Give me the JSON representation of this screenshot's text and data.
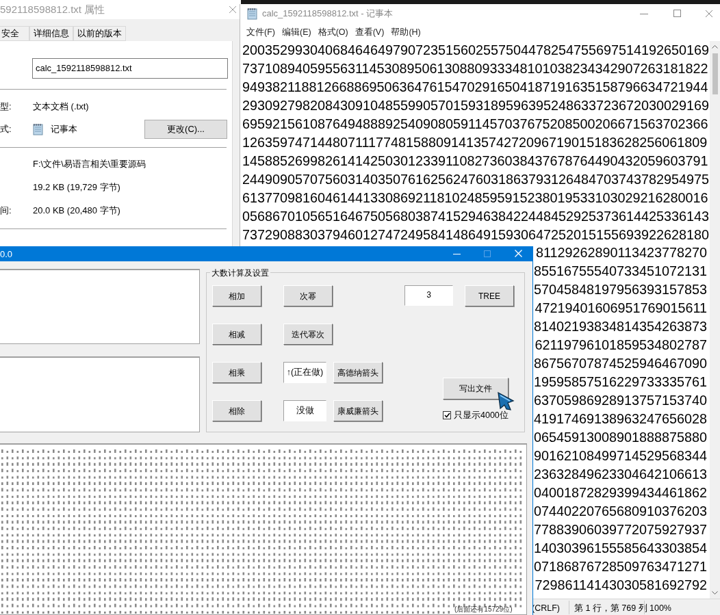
{
  "properties_dialog": {
    "title": "592118598812.txt 属性",
    "tabs": [
      {
        "label": "安全",
        "selected": false
      },
      {
        "label": "详细信息",
        "selected": false
      },
      {
        "label": "以前的版本",
        "selected": false
      }
    ],
    "file_name": "calc_1592118598812.txt",
    "rows": [
      {
        "kind": "text",
        "label": "型:",
        "value": "文本文档 (.txt)"
      },
      {
        "kind": "app",
        "label": "式:",
        "value": "记事本",
        "button": "更改(C)..."
      },
      {
        "kind": "text",
        "value": "F:\\文件\\易语言相关\\重要源码"
      },
      {
        "kind": "text",
        "value": "19.2 KB (19,729 字节)"
      },
      {
        "kind": "text",
        "label": "间:",
        "value": "20.0 KB (20,480 字节)"
      }
    ]
  },
  "notepad": {
    "title": "calc_1592118598812.txt - 记事本",
    "menu": [
      "文件(F)",
      "编辑(E)",
      "格式(O)",
      "查看(V)",
      "帮助(H)"
    ],
    "lines": [
      "20035299304068464649790723515602557504478254755697514192650169",
      "73710894059556311453089506130880933348101038234342907263181822",
      "94938211881266886950636476154702916504187191635158796634721944",
      "29309279820843091048559905701593189596395248633723672030029169",
      "69592156108764948889254090805911457037675208500206671563702366",
      "12635974714480711177481588091413574272096719015183628256061809",
      "14588526998261414250301233911082736038437678764490432059603791",
      "24490905707560314035076162562476031863793126484703743782954975",
      "61377098160461441330869211810248595915238019533103029216280016",
      "05686701056516467505680387415294638422448452925373614425336143",
      "73729088303794601274724958414864915930647252015155693922628180",
      "81129262890113423778270",
      "85516755540733451072131",
      "57045848197956393157853",
      "47219401606951769015611",
      "81402193834814354263873",
      "62119796101859534802787",
      "86756707874525946467090",
      "19595857516229733335761",
      "63705986928913757153740",
      "41917469138963247656028",
      "06545913008901888875880",
      "90162108499714529568344",
      "23632849623304642106613",
      "04001872829399434461862",
      "07440220765680910376203",
      "77883906039772075927937",
      "14030396155585643303854",
      "07186876728509763471271",
      "72986114143030581692792"
    ],
    "status": [
      "(CRLF)",
      "第 1 行，第 769 列",
      "100%"
    ]
  },
  "calculator": {
    "title": "0.0",
    "group_title": "大数计算及设置",
    "controls": [
      {
        "kind": "button",
        "label": "相加"
      },
      {
        "kind": "button",
        "label": "次幂"
      },
      {
        "kind": "field",
        "value": "3"
      },
      {
        "kind": "button",
        "label": "TREE"
      },
      {
        "kind": "button",
        "label": "相减"
      },
      {
        "kind": "button",
        "label": "迭代幂次"
      },
      {
        "kind": "button",
        "label": "相乘"
      },
      {
        "kind": "box",
        "label": "↑(正在做)"
      },
      {
        "kind": "button",
        "label": "高德纳箭头"
      },
      {
        "kind": "button",
        "label": "写出文件"
      },
      {
        "kind": "button",
        "label": "相除"
      },
      {
        "kind": "box",
        "label": "没做"
      },
      {
        "kind": "button",
        "label": "康威廉箭头"
      }
    ],
    "checkbox": {
      "label": "只显示4000位",
      "checked": true
    },
    "output_tail": "(后面还有15729位)"
  }
}
